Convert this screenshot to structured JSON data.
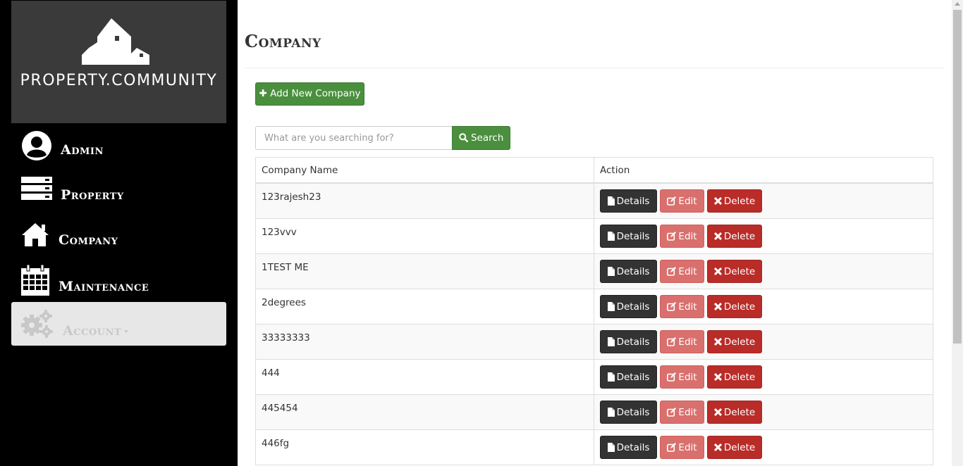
{
  "brand": {
    "name": "PROPERTY.COMMUNITY"
  },
  "nav": {
    "admin": "Admin",
    "property": "Property",
    "company": "Company",
    "maintenance": "Maintenance",
    "account": "Account"
  },
  "page": {
    "title": "Company"
  },
  "toolbar": {
    "add_label": "Add New Company"
  },
  "search": {
    "placeholder": "What are you searching for?",
    "value": "",
    "button_label": "Search"
  },
  "table": {
    "headers": [
      "Company Name",
      "Action"
    ],
    "rows": [
      {
        "name": "123rajesh23"
      },
      {
        "name": "123vvv"
      },
      {
        "name": "1TEST ME"
      },
      {
        "name": "2degrees"
      },
      {
        "name": "33333333"
      },
      {
        "name": "444"
      },
      {
        "name": "445454"
      },
      {
        "name": "446fg"
      }
    ],
    "actions": {
      "details": "Details",
      "edit": "Edit",
      "delete": "Delete"
    }
  },
  "colors": {
    "sidebar_bg": "#000000",
    "logo_bg": "#3a3a3a",
    "primary_green": "#4a8f3d",
    "details_dark": "#333333",
    "edit_pink": "#d9706e",
    "delete_red": "#b92c28"
  }
}
